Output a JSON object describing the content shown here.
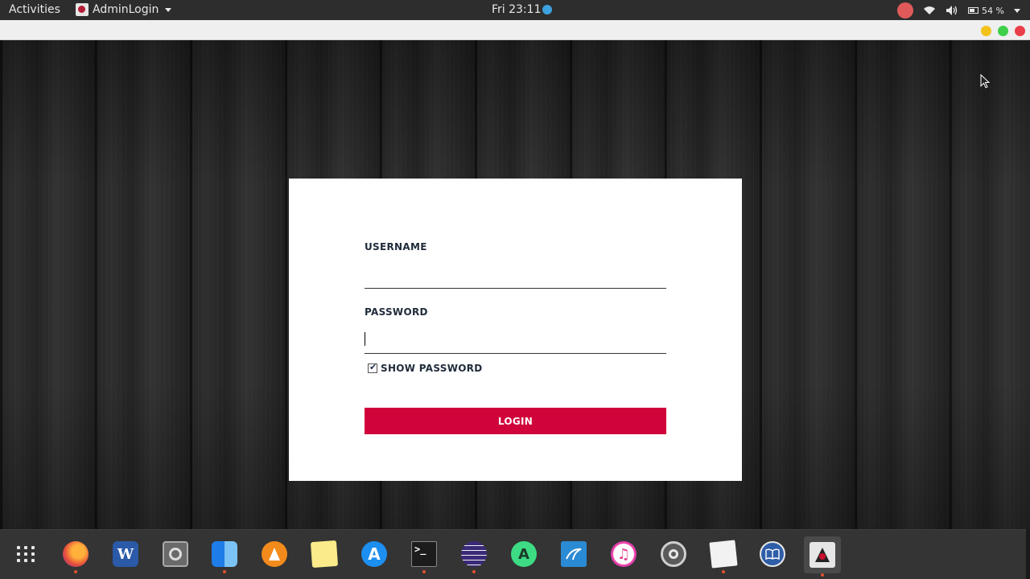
{
  "topbar": {
    "activities": "Activities",
    "app_name": "AdminLogin",
    "clock": "Fri 23:11",
    "battery": "54 %"
  },
  "form": {
    "username_label": "USERNAME",
    "username_value": "",
    "password_label": "PASSWORD",
    "password_value": "",
    "show_password_label": "SHOW PASSWORD",
    "show_password_checked": true,
    "login_label": "LOGIN"
  },
  "colors": {
    "accent": "#d0033b",
    "topbar": "#2d2d2d",
    "dock": "#343434"
  },
  "dock": {
    "items": [
      {
        "icon": "app-grid-icon",
        "running": false
      },
      {
        "icon": "firefox-icon",
        "running": true
      },
      {
        "icon": "word-icon",
        "running": false
      },
      {
        "icon": "disks-icon",
        "running": false
      },
      {
        "icon": "finder-icon",
        "running": true
      },
      {
        "icon": "vlc-icon",
        "running": false
      },
      {
        "icon": "notes-icon",
        "running": false
      },
      {
        "icon": "app-store-icon",
        "running": false
      },
      {
        "icon": "terminal-icon",
        "running": true
      },
      {
        "icon": "eclipse-icon",
        "running": true
      },
      {
        "icon": "android-studio-icon",
        "running": false
      },
      {
        "icon": "mysql-workbench-icon",
        "running": false
      },
      {
        "icon": "itunes-icon",
        "running": false
      },
      {
        "icon": "system-settings-icon",
        "running": false
      },
      {
        "icon": "text-editor-icon",
        "running": true
      },
      {
        "icon": "book-reader-icon",
        "running": false
      },
      {
        "icon": "java-app-icon",
        "running": true
      }
    ]
  }
}
